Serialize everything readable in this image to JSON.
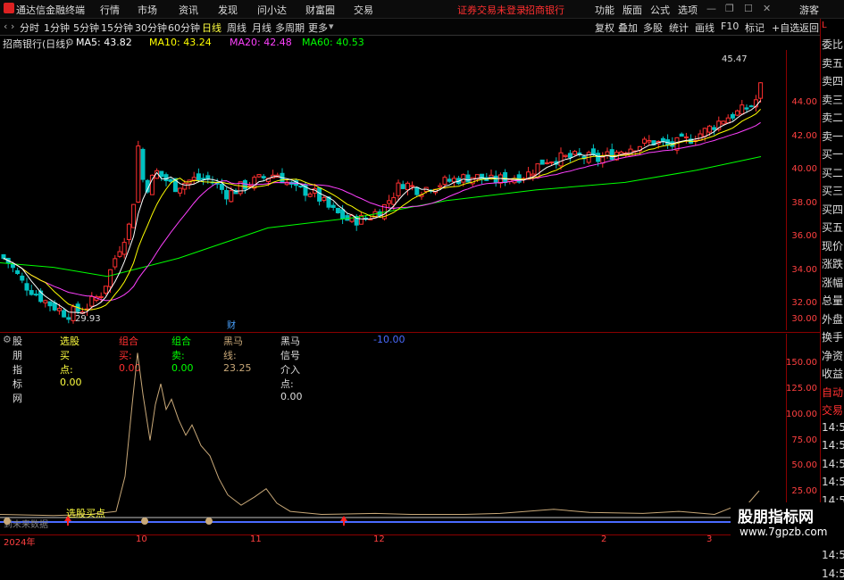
{
  "app": {
    "title": "通达信金融终端",
    "status": "证券交易未登录",
    "stock_name_top": "招商银行"
  },
  "menu": {
    "left": [
      "行情",
      "市场",
      "资讯",
      "发现",
      "问小达",
      "财富圈",
      "交易"
    ],
    "right": [
      "功能",
      "版面",
      "公式",
      "选项"
    ],
    "guest": "游客"
  },
  "toolbar": {
    "periods": [
      "分时",
      "1分钟",
      "5分钟",
      "15分钟",
      "30分钟",
      "60分钟",
      "日线",
      "周线",
      "月线",
      "多周期",
      "更多"
    ],
    "selected": "日线",
    "right": [
      "复权",
      "叠加",
      "多股",
      "统计",
      "画线",
      "F10",
      "标记",
      "+自选",
      "返回"
    ]
  },
  "ma": {
    "title": "招商银行(日线)",
    "ma5": "MA5: 43.82",
    "ma10": "MA10: 43.24",
    "ma20": "MA20: 42.48",
    "ma60": "MA60: 40.53"
  },
  "price_axis": [
    "44.00",
    "42.00",
    "40.00",
    "38.00",
    "36.00",
    "34.00",
    "32.00",
    "30.00"
  ],
  "annotations": {
    "high": "45.47",
    "low": "29.93",
    "cai": "财"
  },
  "indicator": {
    "name": "股朋指标网",
    "xuangu": "选股买点: 0.00",
    "zuhemai": "组合买: 0.00",
    "zuhemai2": "组合卖: 0.00",
    "heima": "黑马线: 23.25",
    "heimaxin": "黑马信号介入点: 0.00",
    "val": "-10.00",
    "xuangu_label": "选股买点",
    "future": "到未来数据"
  },
  "sub_axis": [
    "150.00",
    "125.00",
    "100.00",
    "75.00",
    "50.00",
    "25.00"
  ],
  "x_axis": [
    "2024年",
    "10",
    "11",
    "12",
    "2",
    "3"
  ],
  "right_panel": [
    "委比",
    "卖五",
    "卖四",
    "卖三",
    "卖二",
    "卖一",
    "买一",
    "买二",
    "买三",
    "买四",
    "买五",
    "现价",
    "涨跌",
    "涨幅",
    "总量",
    "外盘",
    "换手",
    "净资",
    "收益",
    "自动",
    "交易",
    "14:5",
    "14:5",
    "14:5",
    "14:5",
    "14:5",
    "14:5",
    "14:5",
    "14:5",
    "14:5"
  ],
  "watermark": {
    "title": "股朋指标网",
    "url": "www.7gpzb.com"
  },
  "colors": {
    "up": "#ff3030",
    "down": "#00c0c0",
    "ma5": "#ffffff",
    "ma10": "#ffff00",
    "ma20": "#ff40ff",
    "ma60": "#00ff00",
    "sub": "#c8a878"
  }
}
